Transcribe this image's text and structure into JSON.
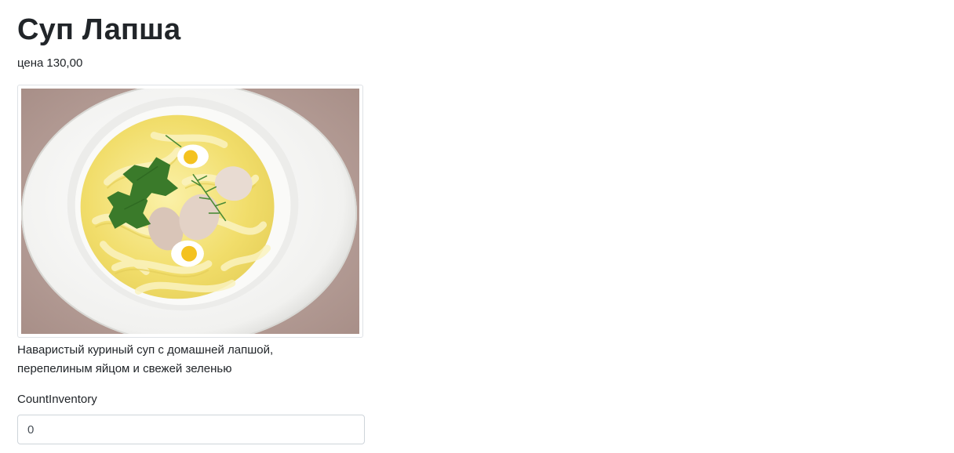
{
  "product": {
    "title": "Суп Лапша",
    "price_label": "цена",
    "price_value": "130,00",
    "description": "Наваристый куриный суп с домашней лапшой, перепелиным яйцом и свежей зеленью"
  },
  "form": {
    "count_label": "CountInventory",
    "count_value": "0"
  },
  "colors": {
    "bowl": "#f4f4f2",
    "broth": "#f3e27a",
    "background_table": "#b59b94"
  },
  "image": {
    "icon": "soup-photo"
  }
}
